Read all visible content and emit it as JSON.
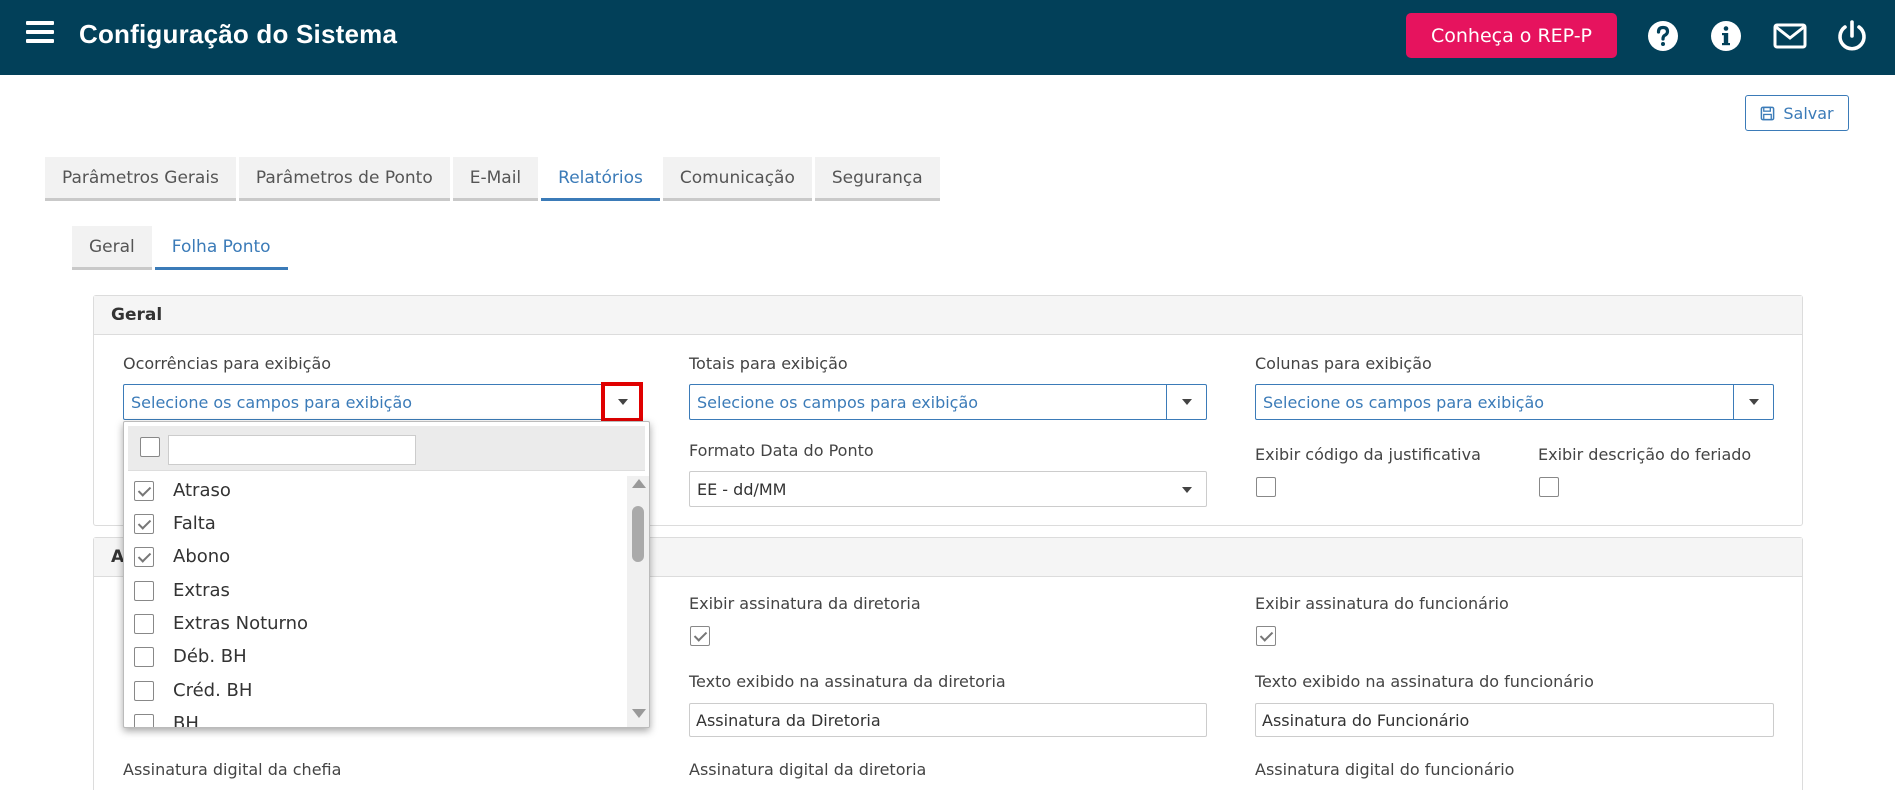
{
  "header": {
    "title": "Configuração do Sistema",
    "rep_button": "Conheça o REP-P",
    "icons": [
      "menu-icon",
      "help-icon",
      "info-icon",
      "mail-icon",
      "power-icon"
    ],
    "bg_color": "#024059",
    "accent_color": "#e6135e"
  },
  "toolbar": {
    "save_label": "Salvar"
  },
  "tabs": [
    {
      "label": "Parâmetros Gerais",
      "active": false
    },
    {
      "label": "Parâmetros de Ponto",
      "active": false
    },
    {
      "label": "E-Mail",
      "active": false
    },
    {
      "label": "Relatórios",
      "active": true
    },
    {
      "label": "Comunicação",
      "active": false
    },
    {
      "label": "Segurança",
      "active": false
    }
  ],
  "subtabs": [
    {
      "label": "Geral",
      "active": false
    },
    {
      "label": "Folha Ponto",
      "active": true
    }
  ],
  "geral": {
    "title": "Geral",
    "ocorrencias_label": "Ocorrências para exibição",
    "totais_label": "Totais para exibição",
    "colunas_label": "Colunas para exibição",
    "select_placeholder": "Selecione os campos para exibição",
    "formato_label": "Formato Data do Ponto",
    "formato_value": "EE - dd/MM",
    "justificativa_label": "Exibir código da justificativa",
    "feriado_label": "Exibir descrição do feriado"
  },
  "assinaturas": {
    "title_partial": "A",
    "diretoria_label": "Exibir assinatura da diretoria",
    "funcionario_label": "Exibir assinatura do funcionário",
    "texto_diretoria_label": "Texto exibido na assinatura da diretoria",
    "texto_funcionario_label": "Texto exibido na assinatura do funcionário",
    "texto_diretoria_value": "Assinatura da Diretoria",
    "texto_funcionario_value": "Assinatura do Funcionário",
    "digital_chefia_label": "Assinatura digital da chefia",
    "digital_diretoria_label": "Assinatura digital da diretoria",
    "digital_funcionario_label": "Assinatura digital do funcionário"
  },
  "dropdown": {
    "items": [
      {
        "label": "Atraso",
        "checked": true
      },
      {
        "label": "Falta",
        "checked": true
      },
      {
        "label": "Abono",
        "checked": true
      },
      {
        "label": "Extras",
        "checked": false
      },
      {
        "label": "Extras Noturno",
        "checked": false
      },
      {
        "label": "Déb. BH",
        "checked": false
      },
      {
        "label": "Créd. BH",
        "checked": false
      },
      {
        "label": "BH",
        "checked": false
      }
    ]
  }
}
